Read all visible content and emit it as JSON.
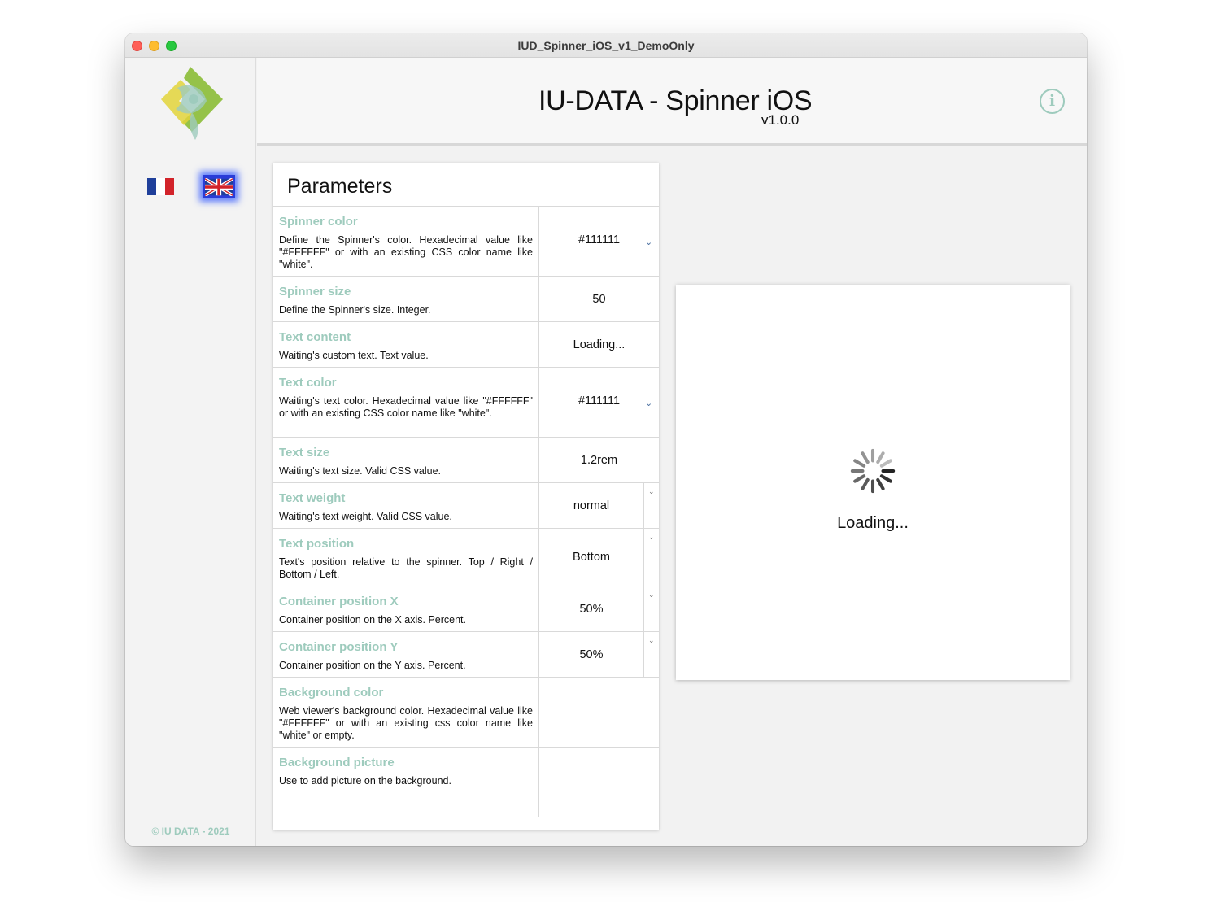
{
  "window": {
    "title": "IUD_Spinner_iOS_v1_DemoOnly"
  },
  "sidebar": {
    "copyright": "© IU DATA - 2021",
    "languages": [
      {
        "code": "fr",
        "colors": [
          "#1f3f9a",
          "#ffffff",
          "#d2232a"
        ]
      },
      {
        "code": "en",
        "selected": true
      }
    ]
  },
  "header": {
    "title": "IU-DATA - Spinner iOS",
    "version": "v1.0.0",
    "info_icon": "info-icon"
  },
  "params": {
    "title": "Parameters",
    "rows": [
      {
        "name": "Spinner color",
        "desc": "Define the Spinner's color. Hexadecimal value like \"#FFFFFF\" or with an existing CSS color name like \"white\".",
        "value": "#111111"
      },
      {
        "name": "Spinner size",
        "desc": "Define the Spinner's size. Integer.",
        "value": "50"
      },
      {
        "name": "Text content",
        "desc": "Waiting's custom text. Text value.",
        "value": "Loading..."
      },
      {
        "name": "Text color",
        "desc": "Waiting's text color. Hexadecimal value like \"#FFFFFF\" or with an existing CSS color name like \"white\".",
        "value": "#111111"
      },
      {
        "name": "Text size",
        "desc": "Waiting's text size. Valid CSS value.",
        "value": "1.2rem"
      },
      {
        "name": "Text weight",
        "desc": "Waiting's text weight. Valid CSS value.",
        "value": "normal"
      },
      {
        "name": "Text position",
        "desc": "Text's position relative to the spinner. Top / Right / Bottom / Left.",
        "value": "Bottom"
      },
      {
        "name": "Container position X",
        "desc": "Container position on the X axis. Percent.",
        "value": "50%"
      },
      {
        "name": "Container position Y",
        "desc": "Container position on the Y axis. Percent.",
        "value": "50%"
      },
      {
        "name": "Background color",
        "desc": "Web viewer's background color. Hexadecimal value like \"#FFFFFF\" or with an existing css color name like \"white\" or empty.",
        "value": ""
      },
      {
        "name": "Background picture",
        "desc": "Use to add picture on the background.",
        "value": ""
      }
    ]
  },
  "preview": {
    "loading_text": "Loading...",
    "spinner_color": "#111111"
  },
  "colors": {
    "accent": "#9ecbbd",
    "selected_glow": "#2850ff"
  }
}
